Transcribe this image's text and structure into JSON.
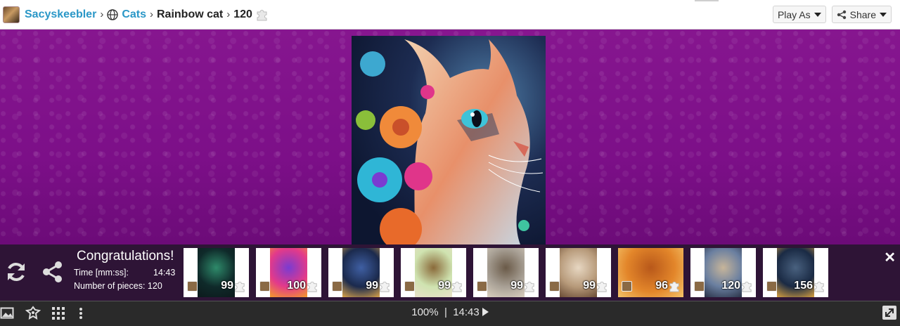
{
  "breadcrumb": {
    "user": "Sacyskeebler",
    "category": "Cats",
    "puzzle": "Rainbow cat",
    "pieces": "120"
  },
  "header": {
    "play_as_label": "Play As",
    "share_label": "Share"
  },
  "completion": {
    "title": "Congratulations!",
    "time_label": "Time [mm:ss]:",
    "time_value": "14:43",
    "pieces_label": "Number of pieces:",
    "pieces_value": "120"
  },
  "suggestions": [
    {
      "count": "99",
      "colors": [
        "#0f2a2a",
        "#2e8a6a",
        "#0c1a1c"
      ]
    },
    {
      "count": "100",
      "colors": [
        "#e33a8a",
        "#7a3bd1",
        "#f39a2a"
      ]
    },
    {
      "count": "99",
      "colors": [
        "#1b2a4d",
        "#3f5fa3",
        "#d8a24a"
      ]
    },
    {
      "count": "99",
      "colors": [
        "#cfe3b0",
        "#8a6a3a",
        "#e8e0c8"
      ]
    },
    {
      "count": "99",
      "colors": [
        "#a8a095",
        "#6a5a48",
        "#d9cfbf"
      ]
    },
    {
      "count": "99",
      "colors": [
        "#b79a7a",
        "#e7d7c2",
        "#6a4c35"
      ]
    },
    {
      "count": "96",
      "colors": [
        "#e3862a",
        "#b8581a",
        "#f4c46a"
      ]
    },
    {
      "count": "120",
      "colors": [
        "#6a7fa0",
        "#c7b59a",
        "#2a3348"
      ]
    },
    {
      "count": "156",
      "colors": [
        "#1a2a44",
        "#49617f",
        "#d8a040"
      ]
    }
  ],
  "status": {
    "zoom": "100%",
    "separator": "|",
    "timer": "14:43"
  },
  "colors": {
    "background": "#7a0e86",
    "link": "#2a97c7",
    "overlay": "#281430",
    "statusbar": "#2a2a2a"
  }
}
